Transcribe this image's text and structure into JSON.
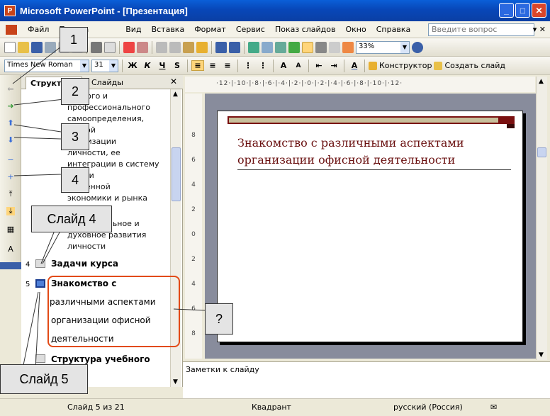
{
  "window": {
    "title": "Microsoft PowerPoint - [Презентация]",
    "app_icon": "P"
  },
  "menu": {
    "items": [
      "Файл",
      "Правка",
      "Вид",
      "Вставка",
      "Формат",
      "Сервис",
      "Показ слайдов",
      "Окно",
      "Справка"
    ],
    "ask_placeholder": "Введите вопрос"
  },
  "toolbar": {
    "zoom": "33%",
    "font": "Times New Roman",
    "size": "31",
    "bold": "Ж",
    "italic": "К",
    "underline": "Ч",
    "shadow": "S",
    "designer": "Конструктор",
    "new_slide": "Создать слайд"
  },
  "outline": {
    "tab_outline": "Структура",
    "tab_slides": "Слайды",
    "text_lines": [
      "турного и",
      "профессионального",
      "самоопределения,",
      "ческой",
      "реализации",
      "личности, ее",
      "интеграции в систему",
      "овой и",
      "ественной",
      "экономики и рынка"
    ],
    "text_lines2": [
      "альное и",
      "духовное развития",
      "личности"
    ],
    "slides": [
      {
        "num": "4",
        "title": "Задачи курса"
      },
      {
        "num": "5",
        "title_lines": [
          "Знакомство с",
          "различными аспектами",
          "организации офисной",
          "деятельности"
        ]
      },
      {
        "num": "",
        "title": "Структура учебного"
      }
    ]
  },
  "slide": {
    "title": "Знакомство с различными аспектами организации офисной деятельности"
  },
  "ruler": {
    "h_ticks": "·12·|·10·|·8·|·6·|·4·|·2·|·0·|·2·|·4·|·6·|·8·|·10·|·12·",
    "v_ticks": [
      "8",
      "6",
      "4",
      "2",
      "0",
      "2",
      "4",
      "6",
      "8"
    ]
  },
  "notes": {
    "placeholder": "Заметки к слайду"
  },
  "status": {
    "slide": "Слайд 5 из 21",
    "design": "Квадрант",
    "language": "русский (Россия)"
  },
  "callouts": {
    "c1": "1",
    "c2": "2",
    "c3": "3",
    "c4": "4",
    "slide4": "Слайд 4",
    "q": "?",
    "slide5": "Слайд 5"
  }
}
